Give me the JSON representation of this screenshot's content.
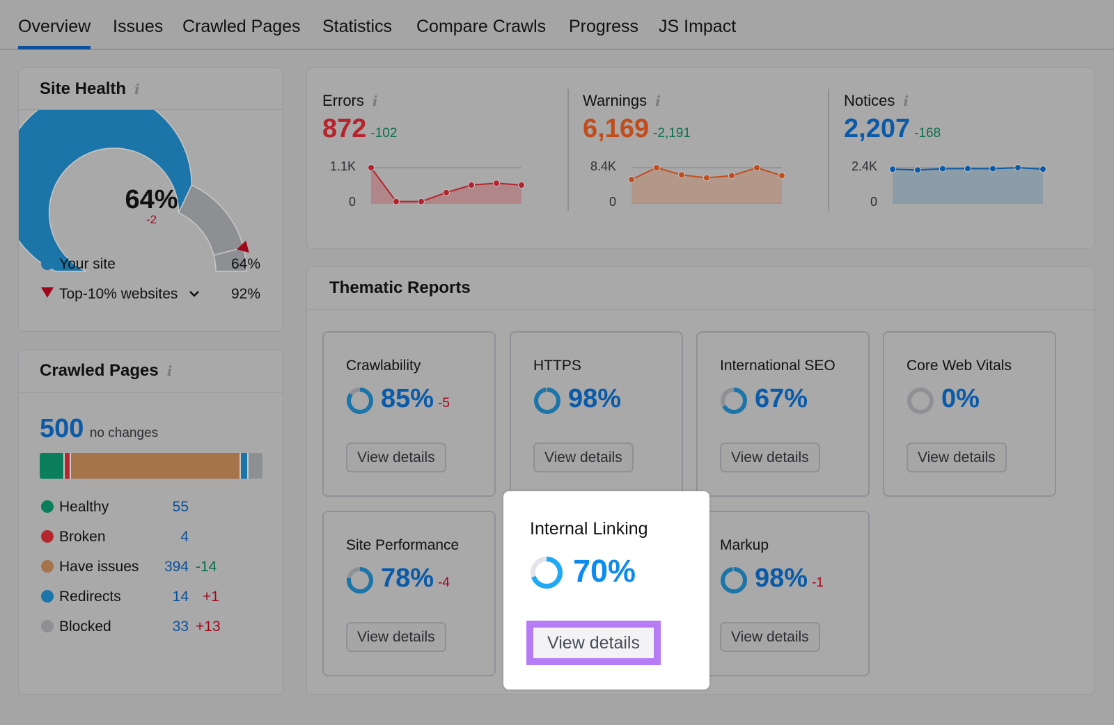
{
  "tabs": [
    {
      "label": "Overview",
      "active": true
    },
    {
      "label": "Issues"
    },
    {
      "label": "Crawled Pages"
    },
    {
      "label": "Statistics"
    },
    {
      "label": "Compare Crawls"
    },
    {
      "label": "Progress"
    },
    {
      "label": "JS Impact"
    }
  ],
  "site_health": {
    "title": "Site Health",
    "info_icon": "i",
    "score_label": "64%",
    "score": 64,
    "delta": "-2",
    "top10_marker": 92,
    "legend": [
      {
        "label": "Your site",
        "value": "64%",
        "icon": "circle",
        "color": "#1d75a8"
      },
      {
        "label": "Top-10% websites",
        "value": "92%",
        "icon": "triangle-down",
        "color": "#a0071b",
        "has_dropdown": true
      }
    ],
    "colors": {
      "site": "#1b75a8",
      "rest": "#8d8f93",
      "marker": "#a0071b"
    }
  },
  "crawled_pages": {
    "title": "Crawled Pages",
    "info_icon": "i",
    "total": "500",
    "total_note": "no changes",
    "rows": [
      {
        "label": "Healthy",
        "count": "55",
        "count_num": 55,
        "delta": "",
        "color": "#0b7f5c"
      },
      {
        "label": "Broken",
        "count": "4",
        "count_num": 4,
        "delta": "",
        "color": "#b4272f"
      },
      {
        "label": "Have issues",
        "count": "394",
        "count_num": 394,
        "delta": "-14",
        "delta_kind": "good",
        "color": "#a6744a"
      },
      {
        "label": "Redirects",
        "count": "14",
        "count_num": 14,
        "delta": "+1",
        "delta_kind": "bad",
        "color": "#1b75a8"
      },
      {
        "label": "Blocked",
        "count": "33",
        "count_num": 33,
        "delta": "+13",
        "delta_kind": "bad",
        "color": "#8d8f93"
      }
    ]
  },
  "metrics": [
    {
      "label": "Errors",
      "value": "872",
      "delta": "-102",
      "color": "#b5232c",
      "fill": "#b08285",
      "axis_max": "1.1K",
      "axis_min": "0",
      "series": [
        1100,
        50,
        50,
        330,
        560,
        620,
        560
      ]
    },
    {
      "label": "Warnings",
      "value": "6,169",
      "delta": "-2,191",
      "color": "#c14d1c",
      "fill": "#b49584",
      "axis_max": "8.4K",
      "axis_min": "0",
      "series": [
        5600,
        8400,
        6700,
        6000,
        6500,
        8400,
        6500
      ]
    },
    {
      "label": "Notices",
      "value": "2,207",
      "delta": "-168",
      "color": "#0a5aa8",
      "fill": "#8a9ba6",
      "axis_max": "2.4K",
      "axis_min": "0",
      "series": [
        2300,
        2250,
        2330,
        2340,
        2330,
        2400,
        2300
      ]
    }
  ],
  "thematic": {
    "title": "Thematic Reports",
    "view_details_label": "View details",
    "reports": [
      {
        "name": "Crawlability",
        "pct": "85%",
        "value": 85,
        "delta": "-5"
      },
      {
        "name": "HTTPS",
        "pct": "98%",
        "value": 98,
        "delta": ""
      },
      {
        "name": "International SEO",
        "pct": "67%",
        "value": 67,
        "delta": ""
      },
      {
        "name": "Core Web Vitals",
        "pct": "0%",
        "value": 0,
        "delta": ""
      },
      {
        "name": "Site Performance",
        "pct": "78%",
        "value": 78,
        "delta": "-4"
      },
      {
        "name": "Internal Linking",
        "pct": "70%",
        "value": 70,
        "delta": "",
        "highlighted": true
      },
      {
        "name": "Markup",
        "pct": "98%",
        "value": 98,
        "delta": "-1"
      }
    ],
    "highlight_color": "#b57cf5"
  }
}
